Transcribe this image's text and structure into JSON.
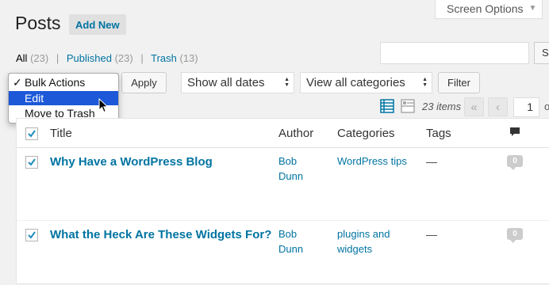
{
  "header": {
    "screen_options_label": "Screen Options",
    "page_title": "Posts",
    "add_new_label": "Add New"
  },
  "filters": {
    "all": {
      "label": "All",
      "count": "(23)"
    },
    "published": {
      "label": "Published",
      "count": "(23)"
    },
    "trash": {
      "label": "Trash",
      "count": "(13)"
    },
    "separator": "|"
  },
  "search": {
    "value": "",
    "button_label": "Se"
  },
  "bulk_actions": {
    "options": [
      {
        "label": "Bulk Actions",
        "checked": true,
        "highlighted": false
      },
      {
        "label": "Edit",
        "checked": false,
        "highlighted": true
      },
      {
        "label": "Move to Trash",
        "checked": false,
        "highlighted": false
      }
    ],
    "check_mark": "✓",
    "apply_label": "Apply"
  },
  "date_filter": {
    "selected": "Show all dates"
  },
  "category_filter": {
    "selected": "View all categories"
  },
  "filter_button_label": "Filter",
  "pagination": {
    "items_count": "23 items",
    "first_label": "«",
    "prev_label": "‹",
    "current_page": "1",
    "of_text": "o"
  },
  "table": {
    "headers": {
      "title": "Title",
      "author": "Author",
      "categories": "Categories",
      "tags": "Tags"
    },
    "rows": [
      {
        "title": "Why Have a WordPress Blog",
        "author_line1": "Bob",
        "author_line2": "Dunn",
        "categories_line1": "WordPress tips",
        "categories_line2": "",
        "tags": "—",
        "comments": "0"
      },
      {
        "title": "What the Heck Are These Widgets For?",
        "author_line1": "Bob",
        "author_line2": "Dunn",
        "categories_line1": "plugins and",
        "categories_line2": "widgets",
        "tags": "—",
        "comments": "0"
      }
    ]
  },
  "colors": {
    "link": "#0074a2",
    "highlight": "#1c58d8",
    "background": "#f1f1f1"
  }
}
